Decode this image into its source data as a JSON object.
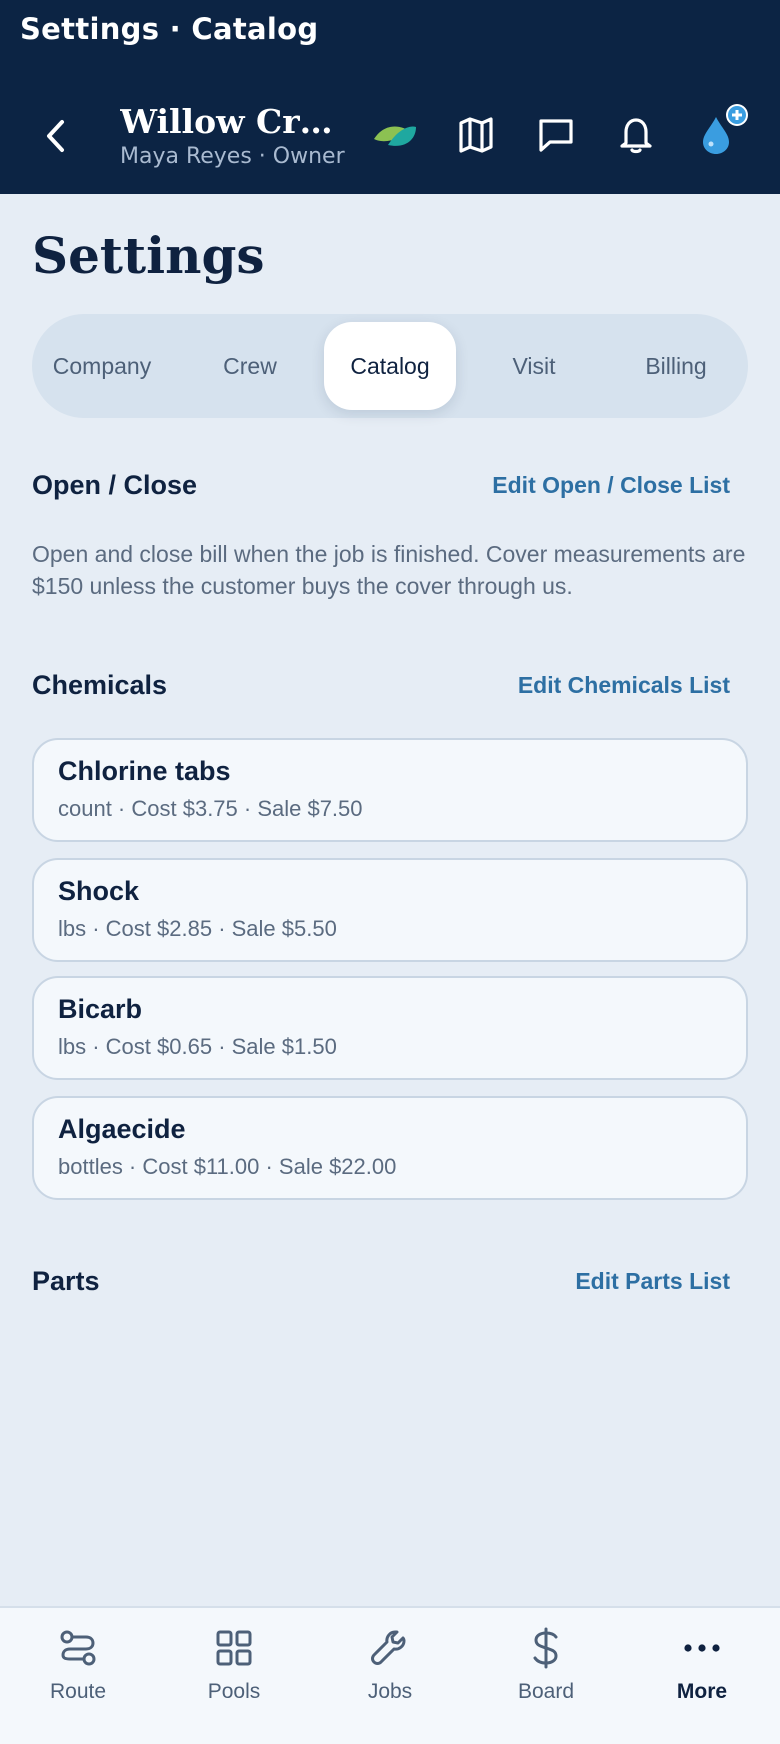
{
  "window": {
    "title": "Settings · Catalog"
  },
  "header": {
    "org_name": "Willow Cree...",
    "org_sub": "Maya Reyes · Owner",
    "icons": [
      "back-icon",
      "leaf-logo-icon",
      "map-icon",
      "chat-icon",
      "bell-icon",
      "water-drop-icon",
      "plus-badge-icon"
    ]
  },
  "page": {
    "title": "Settings"
  },
  "tabs": [
    {
      "label": "Company"
    },
    {
      "label": "Crew"
    },
    {
      "label": "Catalog",
      "active": true
    },
    {
      "label": "Visit"
    },
    {
      "label": "Billing"
    }
  ],
  "sections": {
    "open_close": {
      "title": "Open / Close",
      "link": "Edit Open / Close List",
      "description": "Open and close bill when the job is finished. Cover measurements are $150 unless the customer buys the cover through us."
    },
    "chemicals": {
      "title": "Chemicals",
      "link": "Edit Chemicals List",
      "items": [
        {
          "name": "Chlorine tabs",
          "meta": "count · Cost $3.75 · Sale $7.50"
        },
        {
          "name": "Shock",
          "meta": "lbs · Cost $2.85 · Sale $5.50"
        },
        {
          "name": "Bicarb",
          "meta": "lbs · Cost $0.65 · Sale $1.50"
        },
        {
          "name": "Algaecide",
          "meta": "bottles · Cost $11.00 · Sale $22.00"
        }
      ]
    },
    "parts": {
      "title": "Parts",
      "link": "Edit Parts List"
    }
  },
  "bottom_nav": [
    {
      "label": "Route",
      "icon": "route-icon"
    },
    {
      "label": "Pools",
      "icon": "grid-icon"
    },
    {
      "label": "Jobs",
      "icon": "wrench-icon"
    },
    {
      "label": "Board",
      "icon": "dollar-icon"
    },
    {
      "label": "More",
      "icon": "more-icon",
      "active": true
    }
  ],
  "colors": {
    "header_bg": "#0c2444",
    "page_bg": "#e6edf5",
    "link": "#2d6fa3",
    "drop": "#3a9de0",
    "leaf_green": "#8cc152",
    "leaf_teal": "#1fa8a0"
  }
}
